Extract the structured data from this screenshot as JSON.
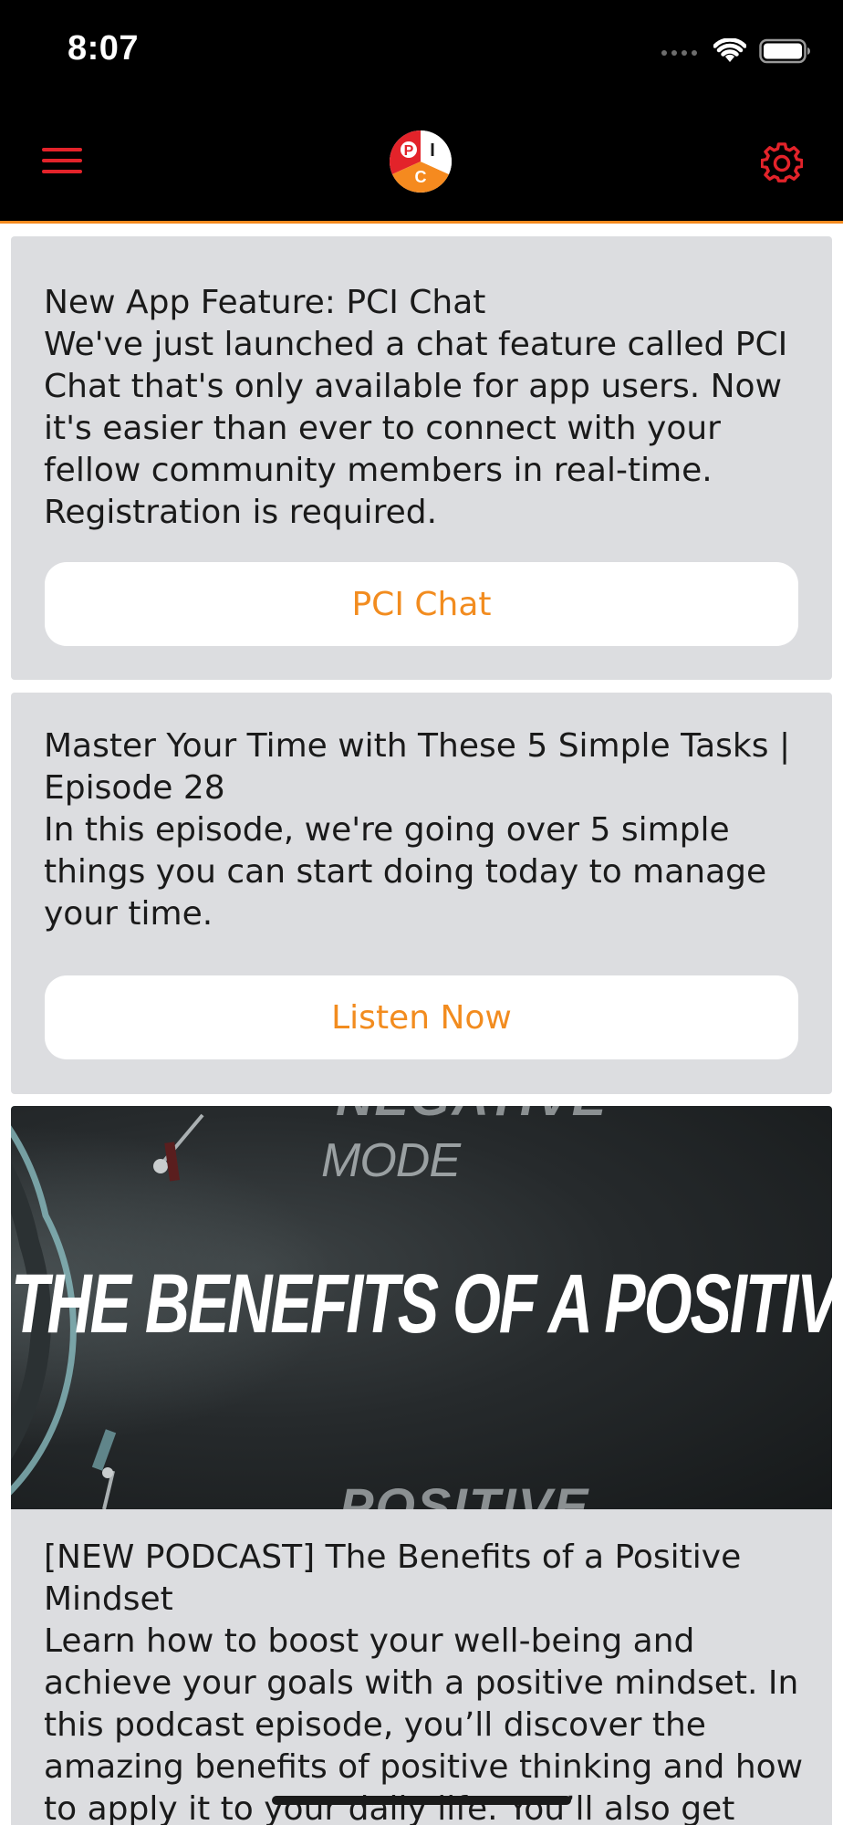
{
  "status_bar": {
    "time": "8:07"
  },
  "nav": {
    "logo_letters": [
      "P",
      "I",
      "C"
    ],
    "menu_icon": "hamburger-menu-icon",
    "settings_icon": "gear-icon",
    "accent_color": "#e3232a",
    "border_color": "#f58a1f"
  },
  "feed": [
    {
      "title": "New App Feature: PCI Chat",
      "body_lines": [
        "We've just launched a chat feature called PCI",
        "Chat that's only available for app users. Now",
        "it's easier than ever to connect with your",
        "fellow community members in real-time.",
        "Registration is required."
      ],
      "button_label": "PCI Chat"
    },
    {
      "title_lines": [
        "Master Your Time with These 5 Simple Tasks |",
        "Episode 28"
      ],
      "body_lines": [
        "In this episode, we're going over 5 simple",
        "things you can start doing today to manage",
        "your time."
      ],
      "button_label": "Listen Now"
    },
    {
      "image_title": "THE BENEFITS OF A POSITIVE MINDSET",
      "image_mode_label": "MODE",
      "image_top_partial": "NEGATIVE",
      "image_bottom_partial": "POSITIVE",
      "title_lines": [
        "[NEW PODCAST] The Benefits of a Positive",
        "Mindset"
      ],
      "body_lines": [
        "Learn how to boost your well-being and",
        "achieve your goals with a positive mindset. In",
        "this podcast episode, you’ll discover the",
        "amazing benefits of positive thinking and how",
        "to apply it to your daily life. You’ll also get"
      ]
    }
  ],
  "colors": {
    "card_bg": "#dcdde0",
    "button_text": "#f28c1f"
  }
}
